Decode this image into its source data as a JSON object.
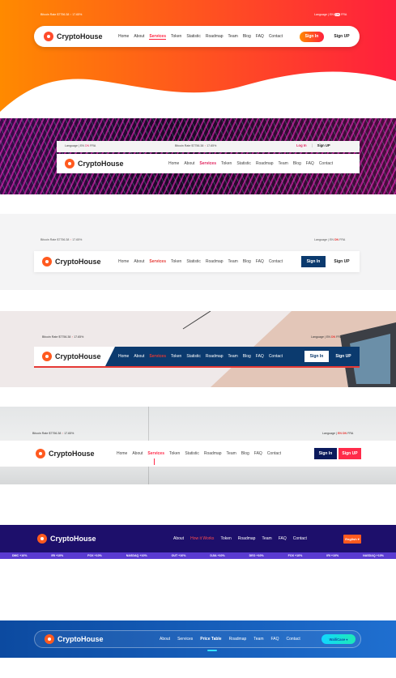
{
  "brand": {
    "name": "CryptoHouse"
  },
  "ticker": {
    "label": "Bitcoin Rate",
    "price": "$7756.38",
    "arrow": "↑",
    "change": "17.65%"
  },
  "language": {
    "label": "Language",
    "options": [
      "EN",
      "DN",
      "FRA"
    ],
    "active": "DN"
  },
  "nav_a": [
    "Home",
    "About",
    "Services",
    "Token",
    "Statistic",
    "Roadmap",
    "Team",
    "Blog",
    "FAQ",
    "Contact"
  ],
  "nav_a_active": "Services",
  "v1": {
    "signin": "Sign In",
    "signup": "Sign UP",
    "colors": {
      "gradient_start": "#ff8a00",
      "gradient_end": "#ff1f3d"
    }
  },
  "v2": {
    "login": "Log In",
    "signup": "Sign UP",
    "accent": "#e0245e"
  },
  "v3": {
    "signin": "Sign In",
    "signup": "Sign UP",
    "accent": "#0b3a6e"
  },
  "v4": {
    "signin": "Sign In",
    "signup": "Sign UP",
    "accent": "#0b3a6e"
  },
  "v5": {
    "signin": "Sign In",
    "signup": "Sign UP",
    "navy": "#0b1a5c",
    "red": "#ff2b4a"
  },
  "v6": {
    "nav": [
      "About",
      "How it Works",
      "Token",
      "Roadmap",
      "Team",
      "FAQ",
      "Contact"
    ],
    "active": "How it Works",
    "lang_button": "English",
    "tickers": [
      "DMC +10%",
      "IRI +10%",
      "FOX +10%",
      "NASDAQ +10%",
      "OUT +10%",
      "DJIA +10%",
      "DEO +10%",
      "FOX +10%",
      "IRI +10%",
      "NASDAQ +10%"
    ]
  },
  "v7": {
    "nav": [
      "About",
      "Services",
      "Price Table",
      "Roadmap",
      "Team",
      "FAQ",
      "Contact"
    ],
    "active": "Price Table",
    "button": "WalliCase"
  }
}
